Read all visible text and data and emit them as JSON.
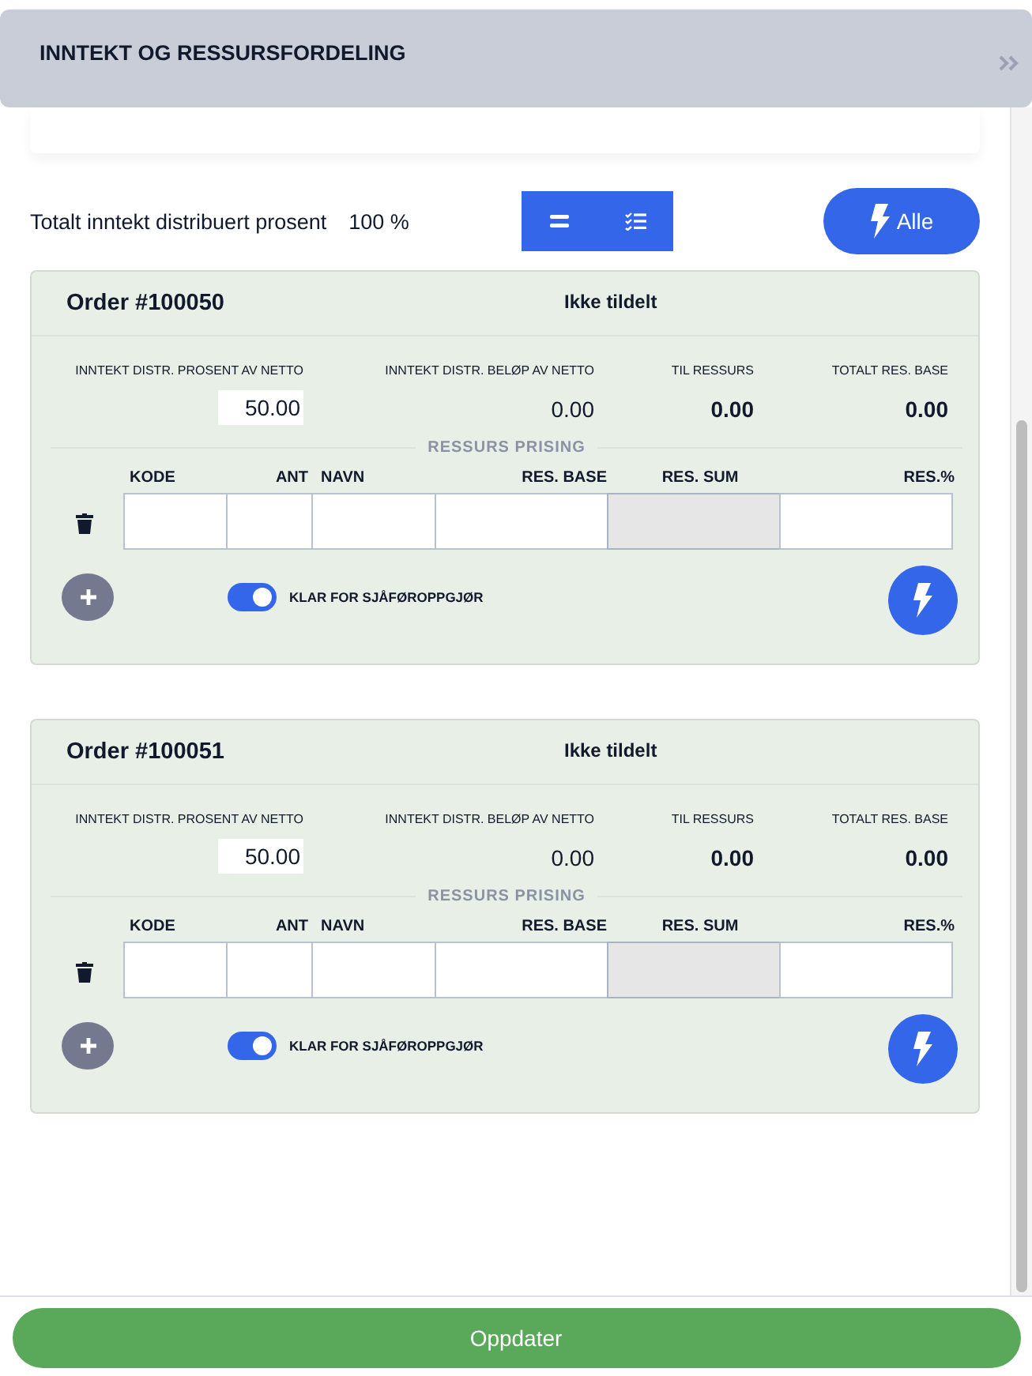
{
  "header": {
    "title": "INNTEKT OG RESSURSFORDELING"
  },
  "summary": {
    "label": "Totalt inntekt distribuert prosent",
    "value": "100 %"
  },
  "view_toggle": [
    {
      "kind": "equal"
    },
    {
      "kind": "checklist"
    }
  ],
  "all_button": {
    "label": "Alle"
  },
  "orders": [
    {
      "title": "Order #100050",
      "status": "Ikke tildelt",
      "stats": [
        {
          "kind": "input",
          "label": "INNTEKT DISTR. PROSENT AV NETTO",
          "value": "50.00"
        },
        {
          "kind": "plain",
          "label": "INNTEKT DISTR. BELØP AV NETTO",
          "value": "0.00"
        },
        {
          "kind": "bold",
          "label": "TIL RESSURS",
          "value": "0.00"
        },
        {
          "kind": "bold",
          "label": "TOTALT RES. BASE",
          "value": "0.00"
        }
      ],
      "section_title": "RESSURS PRISING",
      "columns": [
        {
          "label": "KODE",
          "disabled": false
        },
        {
          "label": "ANT",
          "disabled": false
        },
        {
          "label": "NAVN",
          "disabled": false
        },
        {
          "label": "RES. BASE",
          "disabled": false
        },
        {
          "label": "RES. SUM",
          "disabled": true
        },
        {
          "label": "RES.%",
          "disabled": false
        }
      ],
      "ready": {
        "label": "KLAR FOR SJÅFØROPPGJØR",
        "on": true
      }
    },
    {
      "title": "Order #100051",
      "status": "Ikke tildelt",
      "stats": [
        {
          "kind": "input",
          "label": "INNTEKT DISTR. PROSENT AV NETTO",
          "value": "50.00"
        },
        {
          "kind": "plain",
          "label": "INNTEKT DISTR. BELØP AV NETTO",
          "value": "0.00"
        },
        {
          "kind": "bold",
          "label": "TIL RESSURS",
          "value": "0.00"
        },
        {
          "kind": "bold",
          "label": "TOTALT RES. BASE",
          "value": "0.00"
        }
      ],
      "section_title": "RESSURS PRISING",
      "columns": [
        {
          "label": "KODE",
          "disabled": false
        },
        {
          "label": "ANT",
          "disabled": false
        },
        {
          "label": "NAVN",
          "disabled": false
        },
        {
          "label": "RES. BASE",
          "disabled": false
        },
        {
          "label": "RES. SUM",
          "disabled": true
        },
        {
          "label": "RES.%",
          "disabled": false
        }
      ],
      "ready": {
        "label": "KLAR FOR SJÅFØROPPGJØR",
        "on": true
      }
    }
  ],
  "update_button": {
    "label": "Oppdater"
  }
}
